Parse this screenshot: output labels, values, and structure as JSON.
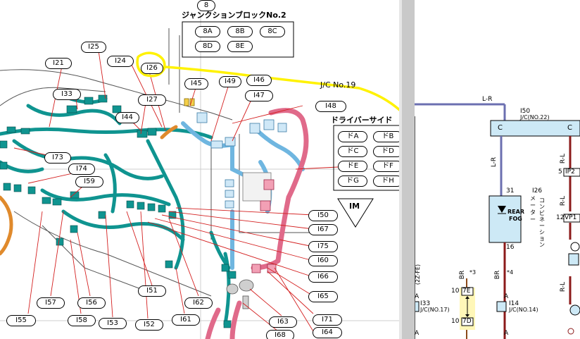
{
  "left_page": {
    "junction_block_title": "ジャンクションブロックNo.2",
    "top_label": "8",
    "jb_connectors": [
      "8A",
      "8B",
      "8C",
      "8D",
      "8E"
    ],
    "jc_label": "J/C No.19",
    "driver_side_title": "ドライバーサイド",
    "driver_side_connectors": [
      "ドA",
      "ドB",
      "ドC",
      "ドD",
      "ドE",
      "ドF",
      "ドG",
      "ドH"
    ],
    "im_label": "IM",
    "connector_labels": {
      "I25": "I25",
      "I21": "I21",
      "I24": "I24",
      "I26": "I26",
      "I33": "I33",
      "I27": "I27",
      "I45": "I45",
      "I49": "I49",
      "I46": "I46",
      "I47": "I47",
      "I48": "I48",
      "I44": "I44",
      "I73": "I73",
      "I74": "I74",
      "I59": "I59",
      "I50": "I50",
      "I67": "I67",
      "I75": "I75",
      "I60": "I60",
      "I66": "I66",
      "I65": "I65",
      "I51": "I51",
      "I57": "I57",
      "I56": "I56",
      "I62": "I62",
      "I55": "I55",
      "I58": "I58",
      "I53": "I53",
      "I52": "I52",
      "I61": "I61",
      "I63": "I63",
      "I71": "I71",
      "I64": "I64",
      "I68": "I68"
    }
  },
  "right_page": {
    "wire_top": "L-R",
    "i50_label": "I50",
    "i50_sub": "J/C(NO.22)",
    "c_left": "C",
    "c_right": "C",
    "wire_left_vertical": "L-R",
    "wire_right_vertical": "R-L",
    "ip2_pin": "5",
    "ip2_label": "IP2",
    "pin_31": "31",
    "i26_label": "I26",
    "i26_sub": "メーター",
    "i26_vertical": "コンビネーション",
    "rear_fog_1": "REAR",
    "rear_fog_2": "FOG",
    "pin_16": "16",
    "pin_12": "12",
    "vp1_label": "VP1",
    "wire_br_1": "BR",
    "br_note_1": "*3",
    "wire_br_2": "BR",
    "br_note_2": "*4",
    "rl_right_2": "R-L",
    "rl_right_3": "R-L",
    "i33_label": "I33",
    "i33_sub": "J/C(NO.17)",
    "i14_label": "I14",
    "i14_sub": "J/C(NO.14)",
    "pin_10a": "10",
    "conn_7e": "7E",
    "pin_10b": "10",
    "conn_7d": "7D",
    "a_labels": [
      "A",
      "A",
      "A",
      "A"
    ],
    "side_text": "(2Z-FE)"
  },
  "colors": {
    "harness_green": "#0f9490",
    "harness_blue": "#6fb6e0",
    "harness_pink": "#e06a8a",
    "harness_orange": "#e08a2c",
    "leader_red": "#d42020",
    "yellow_annotation": "#fff200",
    "wire_dark_red": "#8b1a1a",
    "jb_blue": "#cfe8f7",
    "schematic_box": "#cde9f6",
    "highlight_yellow": "#fff7b8"
  }
}
